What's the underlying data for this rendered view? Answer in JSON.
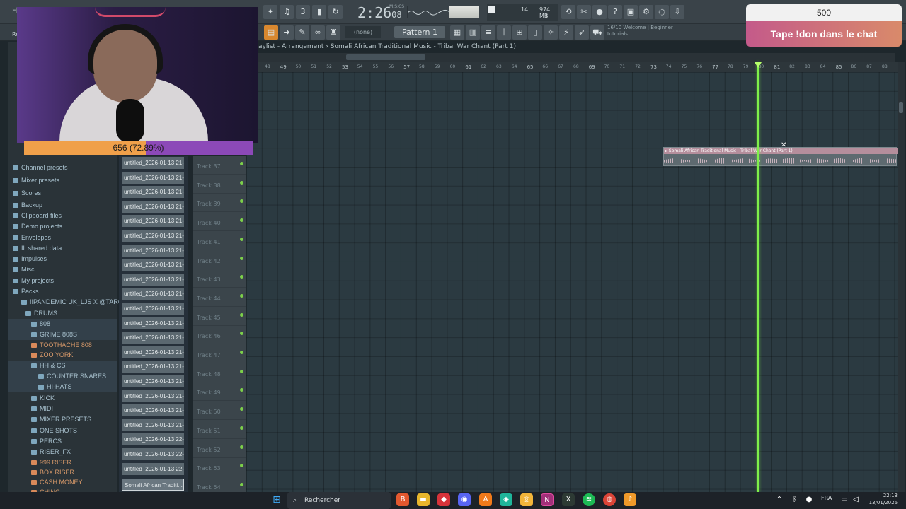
{
  "app": {
    "title_prefix": "Fl",
    "rec_label": "Re"
  },
  "toolbar": {
    "time_main": "2:26",
    "time_sub": "08",
    "time_unit": "M:S:CS",
    "cpu_value": "14",
    "mem_value": "974 MB",
    "mem_sub": "1",
    "pattern_label": "Pattern 1",
    "none_label": "(none)",
    "hint_line1": "16/10  Welcome | Beginner",
    "hint_line2": "tutorials"
  },
  "stream": {
    "goal_text": "656 (72.89%)",
    "goal_fraction": 0.7289,
    "donation_amount": "500",
    "donation_cta": "Tape !don dans le chat"
  },
  "breadcrumb": "aylist - Arrangement  ›  Somali African Traditional Music - Tribal War Chant (Part 1)",
  "browser": {
    "items": [
      {
        "label": "Channel presets",
        "kind": "folder"
      },
      {
        "label": "Mixer presets",
        "kind": "folder"
      },
      {
        "label": "Scores",
        "kind": "folder"
      },
      {
        "label": "Backup",
        "kind": "folder"
      },
      {
        "label": "Clipboard files",
        "kind": "folder"
      },
      {
        "label": "Demo projects",
        "kind": "folder"
      },
      {
        "label": "Envelopes",
        "kind": "folder"
      },
      {
        "label": "IL shared data",
        "kind": "folder"
      },
      {
        "label": "Impulses",
        "kind": "folder"
      },
      {
        "label": "Misc",
        "kind": "folder"
      },
      {
        "label": "My projects",
        "kind": "folder"
      },
      {
        "label": "Packs",
        "kind": "folder"
      },
      {
        "label": "!!PANDEMIC UK_LJS X @TARGETT",
        "kind": "folder"
      },
      {
        "label": "DRUMS",
        "kind": "folder"
      },
      {
        "label": "808",
        "kind": "folder"
      },
      {
        "label": "GRIME 808S",
        "kind": "folder"
      },
      {
        "label": "TOOTHACHE 808",
        "kind": "orange"
      },
      {
        "label": "ZOO YORK",
        "kind": "orange"
      },
      {
        "label": "HH & CS",
        "kind": "folder"
      },
      {
        "label": "COUNTER SNARES",
        "kind": "folder"
      },
      {
        "label": "HI-HATS",
        "kind": "folder"
      },
      {
        "label": "KICK",
        "kind": "folder"
      },
      {
        "label": "MIDI",
        "kind": "folder"
      },
      {
        "label": "MIXER PRESETS",
        "kind": "folder"
      },
      {
        "label": "ONE SHOTS",
        "kind": "folder"
      },
      {
        "label": "PERCS",
        "kind": "folder"
      },
      {
        "label": "RISER_FX",
        "kind": "folder"
      },
      {
        "label": "999 RISER",
        "kind": "orange"
      },
      {
        "label": "BOX RISER",
        "kind": "orange"
      },
      {
        "label": "CASH MONEY",
        "kind": "orange"
      },
      {
        "label": "CHING",
        "kind": "orange"
      }
    ]
  },
  "picker": {
    "items": [
      "untitled_2026-01-13 21-",
      "untitled_2026-01-13 21-",
      "untitled_2026-01-13 21-",
      "untitled_2026-01-13 21-",
      "untitled_2026-01-13 21-",
      "untitled_2026-01-13 21-",
      "untitled_2026-01-13 21-",
      "untitled_2026-01-13 21-",
      "untitled_2026-01-13 21-",
      "untitled_2026-01-13 21-",
      "untitled_2026-01-13 21-",
      "untitled_2026-01-13 21-",
      "untitled_2026-01-13 21-",
      "untitled_2026-01-13 21-",
      "untitled_2026-01-13 21-",
      "untitled_2026-01-13 21-",
      "untitled_2026-01-13 21-",
      "untitled_2026-01-13 21-",
      "untitled_2026-01-13 21-",
      "untitled_2026-01-13 22-",
      "untitled_2026-01-13 22-",
      "untitled_2026-01-13 22-"
    ],
    "selected": "Somali African Traditi..."
  },
  "tracks": [
    "Track 37",
    "Track 38",
    "Track 39",
    "Track 40",
    "Track 41",
    "Track 42",
    "Track 43",
    "Track 44",
    "Track 45",
    "Track 46",
    "Track 47",
    "Track 48",
    "Track 49",
    "Track 50",
    "Track 51",
    "Track 52",
    "Track 53",
    "Track 54"
  ],
  "ruler": {
    "marks": [
      "48",
      "49",
      "50",
      "51",
      "52",
      "53",
      "54",
      "55",
      "56",
      "57",
      "58",
      "59",
      "60",
      "61",
      "62",
      "63",
      "64",
      "65",
      "66",
      "67",
      "68",
      "69",
      "70",
      "71",
      "72",
      "73",
      "74",
      "75",
      "76",
      "77",
      "78",
      "79",
      "80",
      "81",
      "82",
      "83",
      "84",
      "85",
      "86",
      "87",
      "88"
    ],
    "major": [
      "49",
      "53",
      "57",
      "61",
      "65",
      "69",
      "73",
      "77",
      "81",
      "85"
    ]
  },
  "clip": {
    "title": "▸ Somali African Traditional Music - Tribal War Chant (Part 1)"
  },
  "taskbar": {
    "search_placeholder": "Rechercher",
    "lang": "FRA",
    "time": "22:13",
    "date": "13/01/2026"
  },
  "colors": {
    "playhead": "#7ff04a",
    "goal_fill": "#f0a04a",
    "goal_track": "#8c49b8"
  }
}
